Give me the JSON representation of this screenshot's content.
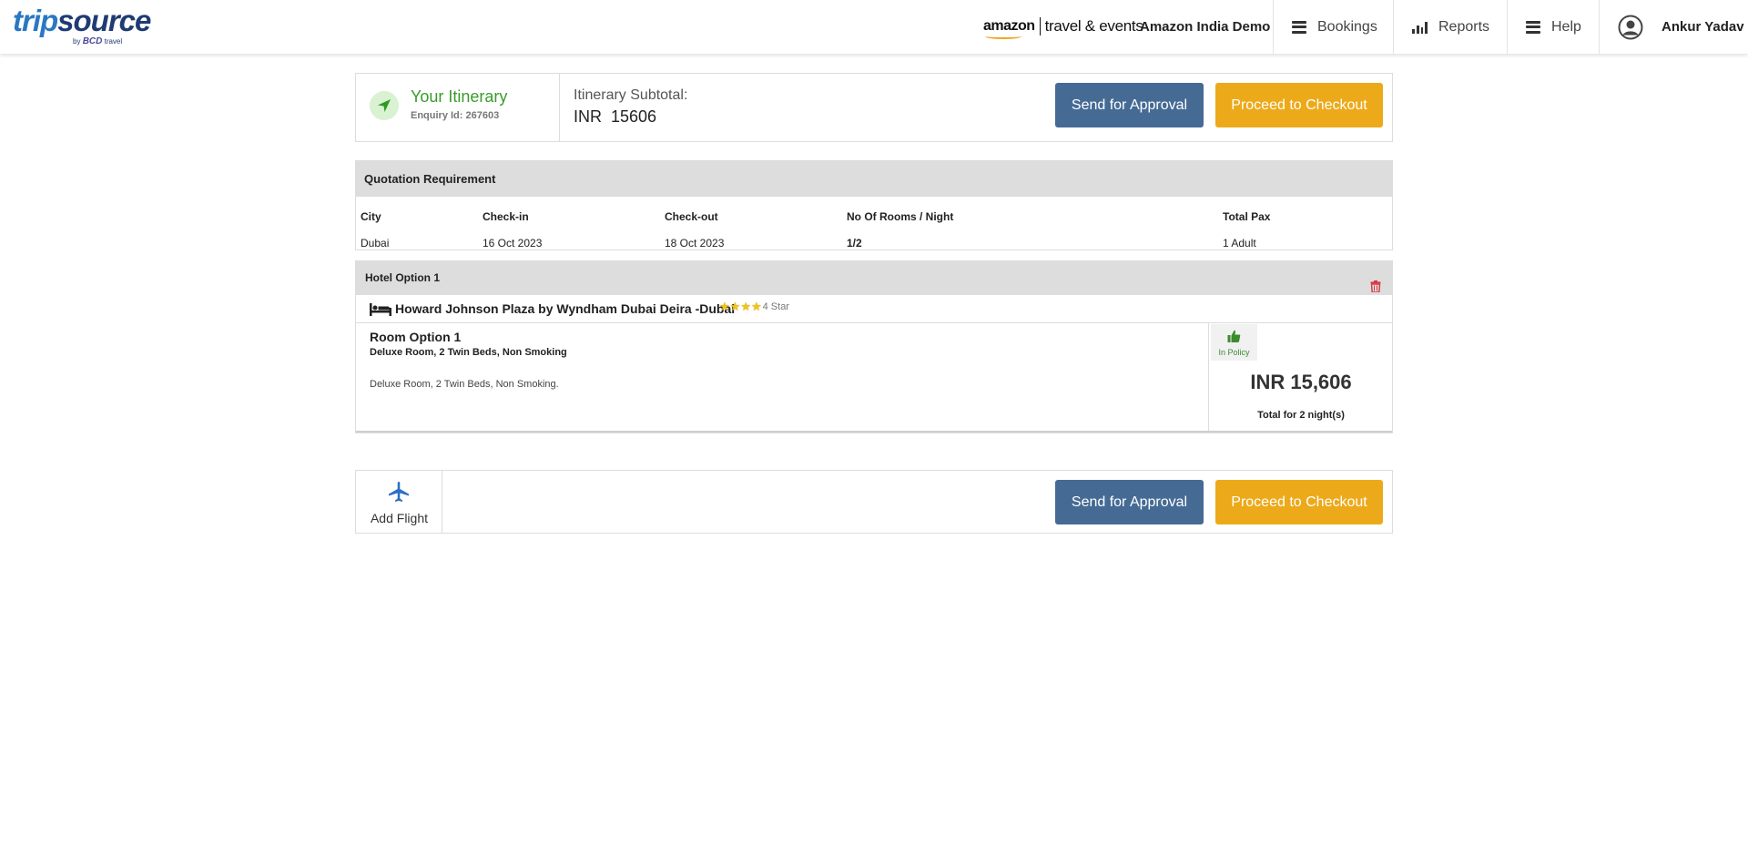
{
  "header": {
    "logo_text_trip": "trip",
    "logo_text_source": "source",
    "logo_sub_by": "by",
    "logo_sub_bcd": "BCD",
    "logo_sub_travel": "travel",
    "partner_amazon": "amazon",
    "partner_text": "travel & events",
    "company": "Amazon India Demo",
    "nav": {
      "bookings": "Bookings",
      "reports": "Reports",
      "help": "Help"
    },
    "user_name": "Ankur Yadav"
  },
  "itinerary": {
    "title": "Your Itinerary",
    "enquiry": "Enquiry Id: 267603",
    "subtotal_label": "Itinerary Subtotal:",
    "subtotal_value": "INR  15606",
    "send_for_approval": "Send for Approval",
    "proceed_to_checkout": "Proceed to Checkout"
  },
  "quotation": {
    "title": "Quotation Requirement",
    "columns": [
      "City",
      "Check-in",
      "Check-out",
      "No Of Rooms / Night",
      "Total Pax"
    ],
    "row": [
      "Dubai",
      "16 Oct 2023",
      "18 Oct 2023",
      "1/2",
      "1 Adult"
    ]
  },
  "hotel_option": {
    "title": "Hotel Option 1",
    "hotel_name": "Howard Johnson Plaza by Wyndham Dubai Deira -Dubai",
    "star_rating": 4,
    "star_label": "4 Star",
    "room": {
      "title": "Room Option 1",
      "type": "Deluxe Room, 2 Twin Beds, Non Smoking",
      "description": "Deluxe Room, 2 Twin Beds, Non Smoking.",
      "policy": "In Policy",
      "price": "INR 15,606",
      "price_note": "Total for 2 night(s)"
    }
  },
  "footer_actions": {
    "add_flight": "Add Flight",
    "send_for_approval": "Send for Approval",
    "proceed_to_checkout": "Proceed to Checkout"
  },
  "colors": {
    "approve_button": "#456b95",
    "checkout_button": "#ecaa1a",
    "itinerary_green": "#3a9b2c",
    "trash_red": "#d9363e",
    "flight_icon_blue": "#2e6fc4"
  },
  "icons": [
    "hamburger-icon",
    "reports-icon",
    "user-avatar-icon",
    "location-arrow-icon",
    "trash-icon",
    "bed-icon",
    "thumbs-up-icon",
    "plane-icon",
    "star-icon"
  ]
}
